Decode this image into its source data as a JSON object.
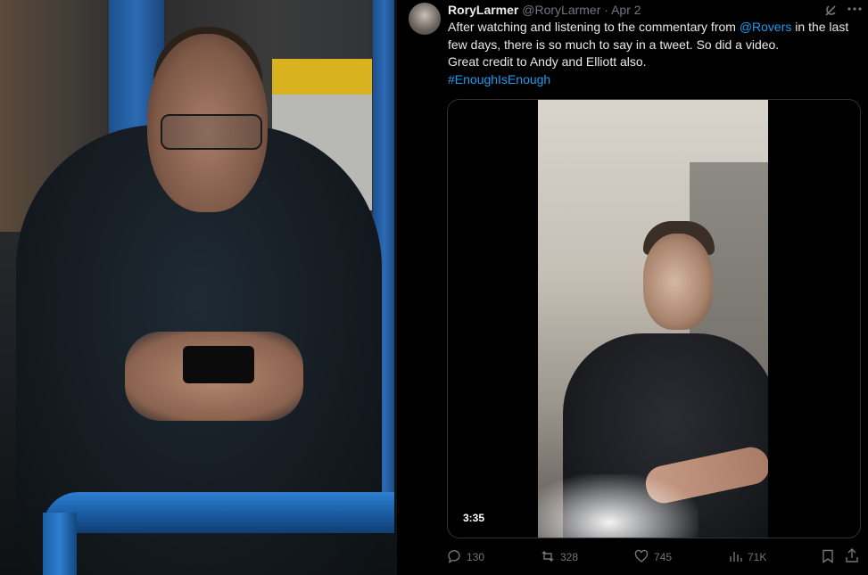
{
  "tweet": {
    "name": "RoryLarmer",
    "handle": "@RoryLarmer",
    "separator": "·",
    "date": "Apr 2",
    "text_line1_a": "After watching and listening to the commentary from ",
    "mention": "@Rovers",
    "text_line1_b": " in the last few days, there is so much to say in a tweet. So did a video.",
    "text_line2": "Great credit to Andy and Elliott also.",
    "hashtag": "#EnoughIsEnough",
    "video_duration": "3:35"
  },
  "actions": {
    "replies": "130",
    "reposts": "328",
    "likes": "745",
    "views": "71K"
  },
  "icons": {
    "reply": "reply-icon",
    "repost": "repost-icon",
    "like": "heart-icon",
    "views": "views-chart-icon",
    "bookmark": "bookmark-icon",
    "share": "share-icon",
    "grok": "grok-icon",
    "more": "more-icon"
  },
  "colors": {
    "link": "#1d9bf0",
    "muted": "#71767b",
    "text": "#e7e9ea",
    "background": "#000000"
  }
}
